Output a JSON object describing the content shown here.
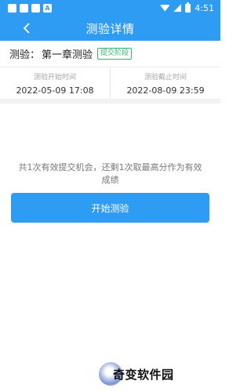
{
  "status_bar": {
    "left_icons": [
      "app-square-icon",
      "app-square-icon",
      "app-square-icon",
      "a-badge-icon"
    ],
    "a_badge": "A",
    "time": "4:51"
  },
  "header": {
    "title": "测验详情",
    "back_icon": "chevron-left-icon"
  },
  "quiz": {
    "label": "测验：",
    "name": "第一章测验",
    "stage": "提交阶段"
  },
  "times": {
    "start_label": "测验开始时间",
    "start_value": "2022-05-09 17:08",
    "end_label": "测验截止时间",
    "end_value": "2022-08-09 23:59"
  },
  "notice": "共1次有效提交机会，还剩1次取最高分作为有效成绩",
  "start_button": "开始测验",
  "watermark": "奇变软件园",
  "colors": {
    "primary": "#2f9cf3",
    "badge_green": "#3ab36e"
  }
}
